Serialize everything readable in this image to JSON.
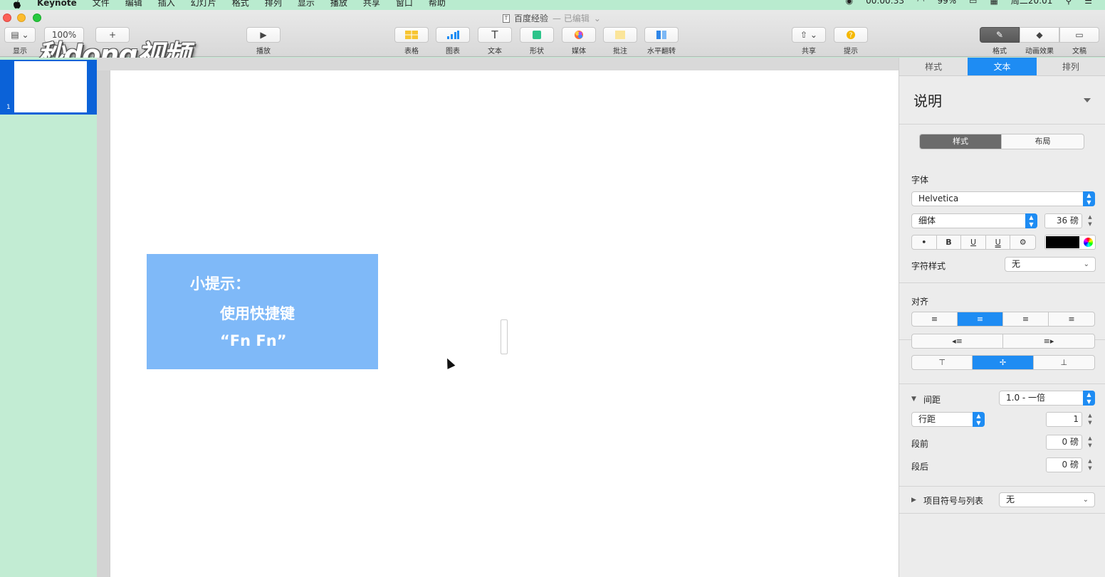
{
  "menubar": {
    "app_name": "Keynote",
    "items": [
      "文件",
      "编辑",
      "插入",
      "幻灯片",
      "格式",
      "排列",
      "显示",
      "播放",
      "共享",
      "窗口",
      "帮助"
    ],
    "recording_time": "00:00:33",
    "battery": "99%",
    "clock": "周二20:01"
  },
  "window": {
    "title": "百度经验",
    "title_suffix": "— 已编辑"
  },
  "toolbar": {
    "view_label": "显示",
    "zoom_value": "100%",
    "play_label": "播放",
    "table_label": "表格",
    "chart_label": "图表",
    "text_label": "文本",
    "shape_label": "形状",
    "media_label": "媒体",
    "comment_label": "批注",
    "flip_label": "水平翻转",
    "share_label": "共享",
    "tips_label": "提示",
    "format_label": "格式",
    "animate_label": "动画效果",
    "document_label": "文稿"
  },
  "watermark": {
    "text": "秒dong视频"
  },
  "navigator": {
    "slide_number": "1"
  },
  "slide": {
    "tip_title": "小提示：",
    "tip_line2": "使用快捷键",
    "tip_line3": "“Fn Fn”"
  },
  "inspector": {
    "tabs": [
      "样式",
      "文本",
      "排列"
    ],
    "paragraph_style": "说明",
    "subtabs": [
      "样式",
      "布局"
    ],
    "font_heading": "字体",
    "font_family": "Helvetica",
    "font_weight": "细体",
    "font_size": "36 磅",
    "format_buttons": [
      "•",
      "B",
      "U",
      "U",
      "⚙"
    ],
    "char_style_label": "字符样式",
    "char_style_value": "无",
    "align_heading": "对齐",
    "spacing_label": "间距",
    "spacing_value": "1.0 - 一倍",
    "line_spacing_label": "行距",
    "line_spacing_value": "1",
    "before_label": "段前",
    "before_value": "0 磅",
    "after_label": "段后",
    "after_value": "0 磅",
    "bullets_label": "项目符号与列表",
    "bullets_value": "无"
  },
  "colors": {
    "menubar_bg": "#b9ebcf",
    "navigator_bg": "#c2ecd3",
    "selected_slide": "#0b62d8",
    "accent_blue": "#1e8cf3",
    "tip_box": "#7fb9f8"
  }
}
